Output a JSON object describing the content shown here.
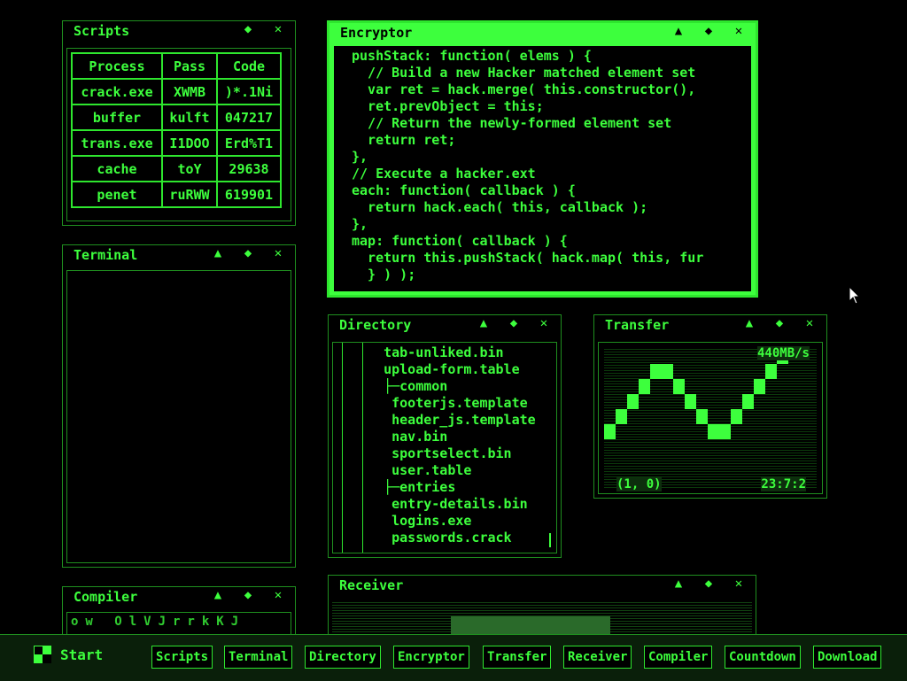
{
  "windows": {
    "scripts": {
      "title": "Scripts",
      "headers": [
        "Process",
        "Pass",
        "Code"
      ],
      "rows": [
        [
          "crack.exe",
          "XWMB",
          ")*.1Ni"
        ],
        [
          "buffer",
          "kulft",
          "047217"
        ],
        [
          "trans.exe",
          "I1DOO",
          "Erd%T1"
        ],
        [
          "cache",
          "toY",
          "29638"
        ],
        [
          "penet",
          "ruRWW",
          "619901"
        ]
      ]
    },
    "terminal": {
      "title": "Terminal"
    },
    "encryptor": {
      "title": "Encryptor",
      "code_lines": [
        "pushStack: function( elems ) {",
        "  // Build a new Hacker matched element set",
        "  var ret = hack.merge( this.constructor(),",
        "  ret.prevObject = this;",
        "  // Return the newly-formed element set",
        "  return ret;",
        "},",
        "// Execute a hacker.ext",
        "each: function( callback ) {",
        "  return hack.each( this, callback );",
        "},",
        "map: function( callback ) {",
        "  return this.pushStack( hack.map( this, fur",
        "  } ) );"
      ]
    },
    "directory": {
      "title": "Directory",
      "items": [
        "   tab-unliked.bin",
        "   upload-form.table",
        "   ├─common",
        "    footerjs.template",
        "    header_js.template",
        "    nav.bin",
        "    sportselect.bin",
        "    user.table",
        "   ├─entries",
        "    entry-details.bin",
        "    logins.exe",
        "    passwords.crack"
      ]
    },
    "transfer": {
      "title": "Transfer",
      "speed": "440MB/s",
      "coord": "(1, 0)",
      "time": "23:7:2"
    },
    "receiver": {
      "title": "Receiver"
    },
    "compiler": {
      "title": "Compiler",
      "chars": "ow OlVJrrkKJ"
    }
  },
  "controls": {
    "minimize": "▲",
    "resize": "◆",
    "close": "✕"
  },
  "taskbar": {
    "start": "Start",
    "buttons": [
      "Scripts",
      "Terminal",
      "Directory",
      "Encryptor",
      "Transfer",
      "Receiver",
      "Compiler",
      "Countdown",
      "Download"
    ]
  }
}
